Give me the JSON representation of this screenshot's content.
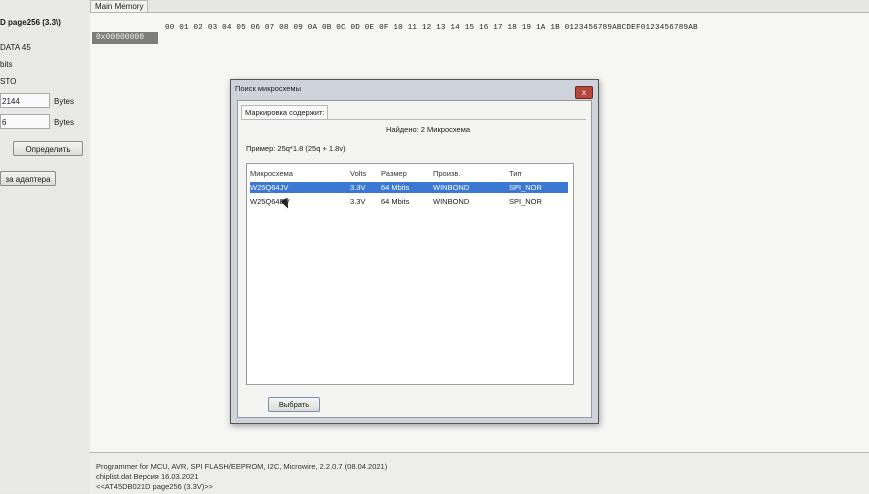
{
  "left": {
    "chip_title": "D page256 (3.3\\)",
    "line1": "DATA 45",
    "line2": "bits",
    "line3": "STO",
    "field1": "2144",
    "unit1": "Bytes",
    "field2": "6",
    "unit2": "Bytes",
    "detect_button": "Определить",
    "adapter_button": "за адаптера"
  },
  "memory": {
    "tab": "Main Memory",
    "hex_header": "00 01 02 03 04 05 06 07 08 09 0A 0B 0C 0D 0E 0F 10 11 12 13 14 15 16 17 18 19 1A 1B   0123456789ABCDEF0123456789AB",
    "address": "0x00000000"
  },
  "log": {
    "line1": "Programmer for MCU, AVR, SPI FLASH/EEPROM, I2C, Microwire, 2.2.0.7 (08.04.2021)",
    "line2": "chiplist.dat Версия 16.03.2021",
    "line3": "<<AT45DB021D page256 (3.3V)>>"
  },
  "dialog": {
    "title": "Поиск микросхемы",
    "close": "x",
    "tab": "Маркировка содержит:",
    "found": "Найдено: 2 Микросхема",
    "example": "Пример:  25q*1.8 (25q + 1.8v)",
    "columns": [
      "Микросхема",
      "Volts",
      "Размер",
      "Произв.",
      "Тип"
    ],
    "rows": [
      {
        "chip": "W25Q64JV",
        "volts": "3.3V",
        "size": "64 Mbits",
        "vendor": "WINBOND",
        "type": "SPI_NOR"
      },
      {
        "chip": "W25Q64BV",
        "volts": "3.3V",
        "size": "64 Mbits",
        "vendor": "WINBOND",
        "type": "SPI_NOR"
      }
    ],
    "select_button": "Выбрать"
  },
  "colors": {
    "selection": "#3a78d4",
    "close_button": "#b7473a"
  }
}
